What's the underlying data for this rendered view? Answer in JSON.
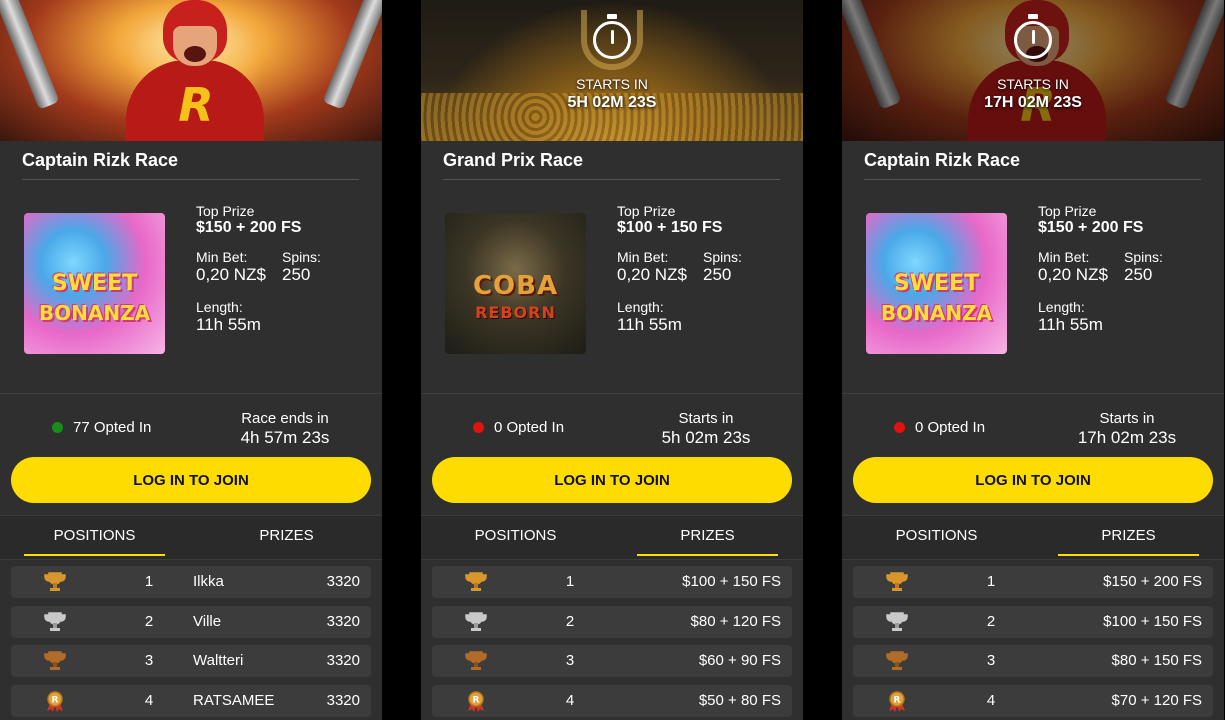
{
  "colors": {
    "accent": "#fedc00",
    "card_bg": "#2f2f2f",
    "row_bg": "#3c3c3c",
    "green_dot": "#1a8c1a",
    "red_dot": "#e0130f"
  },
  "cards": [
    {
      "title": "Captain Rizk Race",
      "banner": "captain-rizk-hero",
      "game_tile": {
        "line1": "SWEET",
        "line2": "BONANZA"
      },
      "top_prize_label": "Top Prize",
      "top_prize": "$150 + 200 FS",
      "min_bet_label": "Min Bet:",
      "min_bet": "0,20 NZ$",
      "spins_label": "Spins:",
      "spins": "250",
      "length_label": "Length:",
      "length": "11h 55m",
      "opted_in": "77 Opted In",
      "status_color": "green",
      "race_label": "Race ends in",
      "race_value": "4h 57m 23s",
      "join_label": "LOG IN TO JOIN",
      "tabs": [
        "POSITIONS",
        "PRIZES"
      ],
      "active_tab": "POSITIONS",
      "rows": [
        {
          "icon": "gold-trophy-icon",
          "rank": "1",
          "name": "Ilkka",
          "value": "3320"
        },
        {
          "icon": "silver-trophy-icon",
          "rank": "2",
          "name": "Ville",
          "value": "3320"
        },
        {
          "icon": "bronze-trophy-icon",
          "rank": "3",
          "name": "Waltteri",
          "value": "3320"
        },
        {
          "icon": "medal-icon",
          "rank": "4",
          "name": "RATSAMEE",
          "value": "3320"
        }
      ]
    },
    {
      "title": "Grand Prix Race",
      "banner": "trophy-stadium",
      "starts_label": "STARTS IN",
      "starts_value": "5H 02M 23S",
      "game_tile": {
        "line1": "COBA",
        "line2": "REBORN"
      },
      "top_prize_label": "Top Prize",
      "top_prize": "$100 + 150 FS",
      "min_bet_label": "Min Bet:",
      "min_bet": "0,20 NZ$",
      "spins_label": "Spins:",
      "spins": "250",
      "length_label": "Length:",
      "length": "11h 55m",
      "opted_in": "0 Opted In",
      "status_color": "red",
      "race_label": "Starts in",
      "race_value": "5h 02m 23s",
      "join_label": "LOG IN TO JOIN",
      "tabs": [
        "POSITIONS",
        "PRIZES"
      ],
      "active_tab": "PRIZES",
      "rows": [
        {
          "icon": "gold-trophy-icon",
          "rank": "1",
          "name": "",
          "value": "$100 + 150 FS"
        },
        {
          "icon": "silver-trophy-icon",
          "rank": "2",
          "name": "",
          "value": "$80 + 120 FS"
        },
        {
          "icon": "bronze-trophy-icon",
          "rank": "3",
          "name": "",
          "value": "$60 + 90 FS"
        },
        {
          "icon": "medal-icon",
          "rank": "4",
          "name": "",
          "value": "$50 + 80 FS"
        }
      ]
    },
    {
      "title": "Captain Rizk Race",
      "banner": "captain-rizk-stadium",
      "starts_label": "STARTS IN",
      "starts_value": "17H 02M 23S",
      "game_tile": {
        "line1": "SWEET",
        "line2": "BONANZA"
      },
      "top_prize_label": "Top Prize",
      "top_prize": "$150 + 200 FS",
      "min_bet_label": "Min Bet:",
      "min_bet": "0,20 NZ$",
      "spins_label": "Spins:",
      "spins": "250",
      "length_label": "Length:",
      "length": "11h 55m",
      "opted_in": "0 Opted In",
      "status_color": "red",
      "race_label": "Starts in",
      "race_value": "17h 02m 23s",
      "join_label": "LOG IN TO JOIN",
      "tabs": [
        "POSITIONS",
        "PRIZES"
      ],
      "active_tab": "PRIZES",
      "rows": [
        {
          "icon": "gold-trophy-icon",
          "rank": "1",
          "name": "",
          "value": "$150 + 200 FS"
        },
        {
          "icon": "silver-trophy-icon",
          "rank": "2",
          "name": "",
          "value": "$100 + 150 FS"
        },
        {
          "icon": "bronze-trophy-icon",
          "rank": "3",
          "name": "",
          "value": "$80 + 150 FS"
        },
        {
          "icon": "medal-icon",
          "rank": "4",
          "name": "",
          "value": "$70 + 120 FS"
        }
      ]
    }
  ]
}
